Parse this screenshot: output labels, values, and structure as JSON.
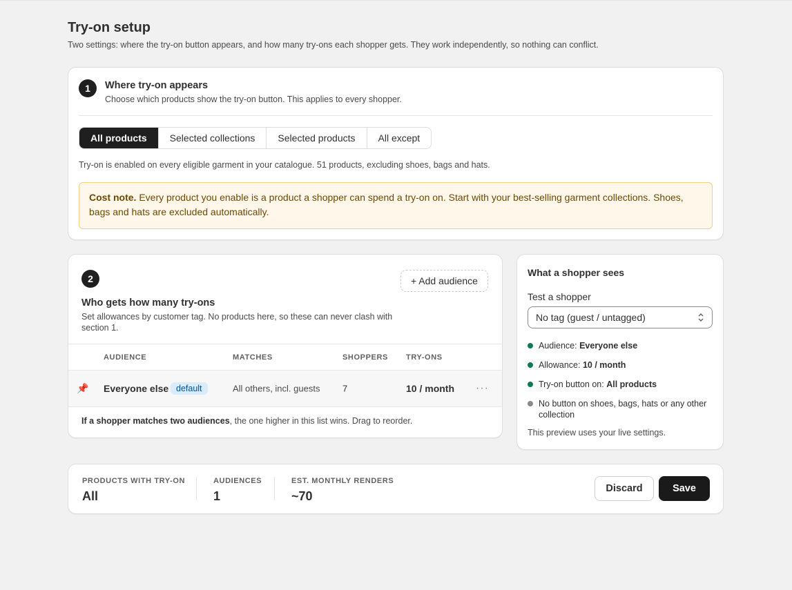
{
  "page": {
    "title": "Try-on setup",
    "subtitle": "Two settings: where the try-on button appears, and how many try-ons each shopper gets. They work independently, so nothing can conflict."
  },
  "section1": {
    "step": "1",
    "title": "Where try-on appears",
    "description": "Choose which products show the try-on button. This applies to every shopper.",
    "tabs": [
      {
        "label": "All products",
        "active": true
      },
      {
        "label": "Selected collections",
        "active": false
      },
      {
        "label": "Selected products",
        "active": false
      },
      {
        "label": "All except",
        "active": false
      }
    ],
    "info": "Try-on is enabled on every eligible garment in your catalogue. 51 products, excluding shoes, bags and hats.",
    "note_bold": "Cost note.",
    "note_text": " Every product you enable is a product a shopper can spend a try-on on. Start with your best-selling garment collections. Shoes, bags and hats are excluded automatically."
  },
  "section2": {
    "step": "2",
    "title": "Who gets how many try-ons",
    "description": "Set allowances by customer tag. No products here, so these can never clash with section 1.",
    "add_button": "+ Add audience",
    "columns": [
      "AUDIENCE",
      "MATCHES",
      "SHOPPERS",
      "TRY-ONS"
    ],
    "rows": [
      {
        "icon": "pin-icon",
        "audience": "Everyone else",
        "badge": "default",
        "matches": "All others, incl. guests",
        "shoppers": "7",
        "tryons": "10 / month",
        "more": "···"
      }
    ],
    "footer_bold": "If a shopper matches two audiences",
    "footer_text": ", the one higher in this list wins. Drag to reorder."
  },
  "preview": {
    "title": "What a shopper sees",
    "test_label": "Test a shopper",
    "select_value": "No tag (guest / untagged)",
    "items": [
      {
        "label": "Audience: ",
        "value": "Everyone else",
        "color": "#0c7a52"
      },
      {
        "label": "Allowance: ",
        "value": "10 / month",
        "color": "#0c7a52"
      },
      {
        "label": "Try-on button on: ",
        "value": "All products",
        "color": "#0c7a52"
      },
      {
        "label": "No button on shoes, bags, hats or any other collection",
        "value": "",
        "color": "#8a8a8a"
      }
    ],
    "footer": "This preview uses your live settings."
  },
  "summary": {
    "stats": [
      {
        "label": "PRODUCTS WITH TRY-ON",
        "value": "All"
      },
      {
        "label": "AUDIENCES",
        "value": "1"
      },
      {
        "label": "EST. MONTHLY RENDERS",
        "value": "~70"
      }
    ],
    "discard": "Discard",
    "save": "Save"
  },
  "colors": {
    "accent_dark": "#1f1f1f",
    "success": "#0c7a52",
    "note_bg": "#fff8ea",
    "badge_bg": "#d8ecfb"
  }
}
